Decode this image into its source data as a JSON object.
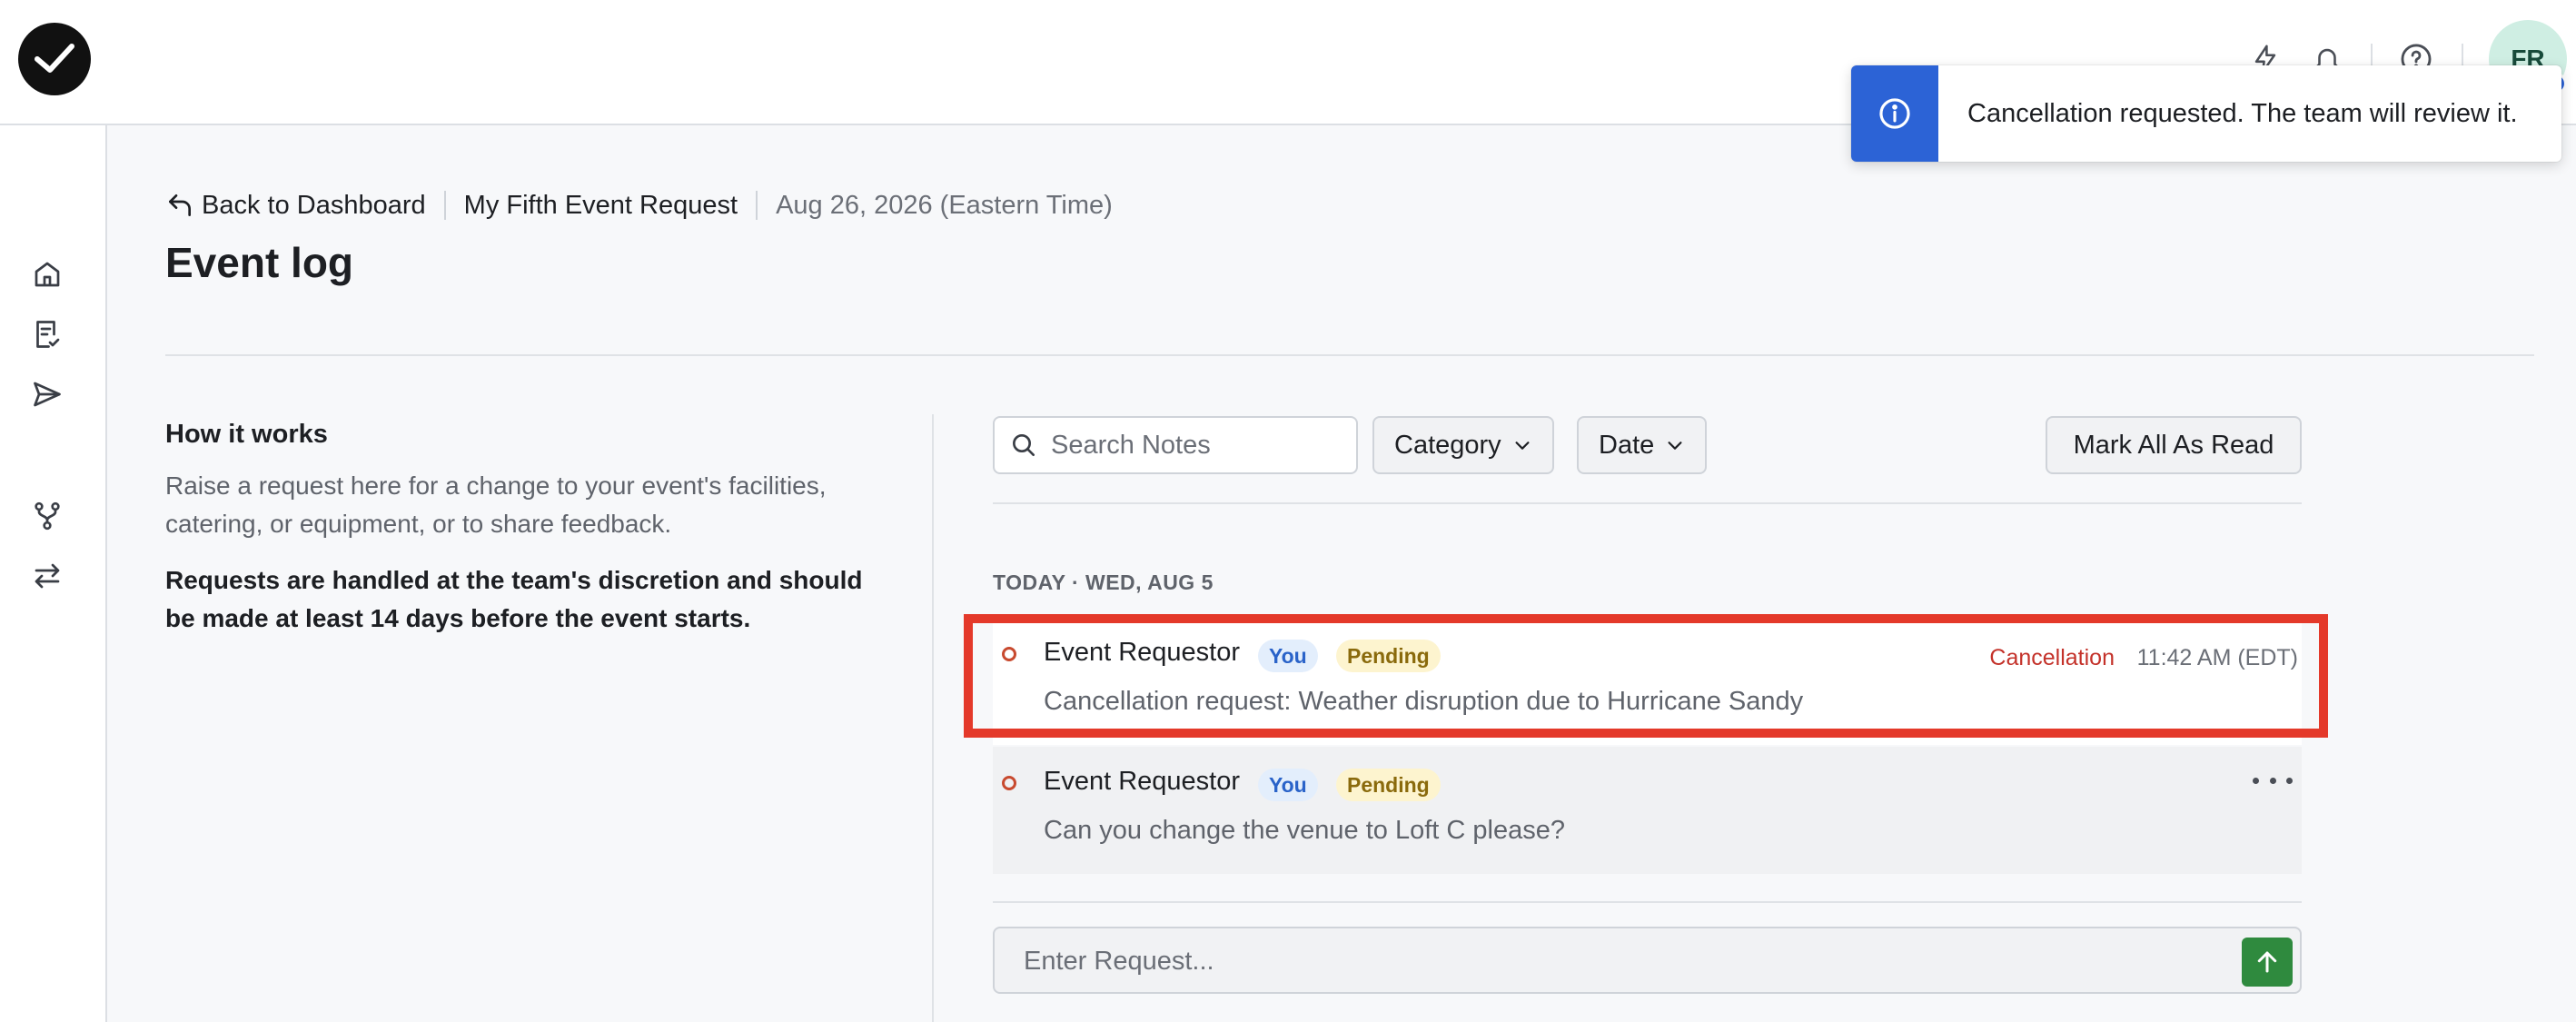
{
  "topbar": {
    "logo": "checkmark-logo",
    "icons": [
      "lightning-icon",
      "bell-icon",
      "help-icon"
    ],
    "avatar_initials": "FR"
  },
  "toast": {
    "message": "Cancellation requested. The team will review it.",
    "icon": "info-icon"
  },
  "sidebar": {
    "items": [
      "home-icon",
      "checklist-icon",
      "send-icon",
      "branch-icon",
      "swap-icon"
    ]
  },
  "breadcrumb": {
    "back_label": "Back to Dashboard",
    "event_name": "My Fifth Event Request",
    "event_date": "Aug 26, 2026 (Eastern Time)"
  },
  "page": {
    "title": "Event log"
  },
  "info": {
    "title": "How it works",
    "body": "Raise a request here for a change to your event's facilities, catering, or equipment, or to share feedback.",
    "note": "Requests are handled at the team's discretion and should be made at least 14 days before the event starts."
  },
  "filters": {
    "search_placeholder": "Search Notes",
    "category_label": "Category",
    "date_label": "Date",
    "mark_all_read_label": "Mark All As Read"
  },
  "log": {
    "day_label": "TODAY · WED, AUG 5",
    "events": [
      {
        "author": "Event Requestor",
        "you_badge": "You",
        "status": "Pending",
        "category": "Cancellation",
        "time": "11:42 AM (EDT)",
        "message": "Cancellation request: Weather disruption due to Hurricane Sandy",
        "highlighted": true
      },
      {
        "author": "Event Requestor",
        "you_badge": "You",
        "status": "Pending",
        "message": "Can you change the venue to Loft C please?",
        "highlighted": false
      }
    ]
  },
  "composer": {
    "placeholder": "Enter Request..."
  },
  "colors": {
    "toast_accent": "#2c63d6",
    "highlight_border": "#e4392a",
    "send_button": "#2f8a3e",
    "category_text": "#c4322a"
  }
}
